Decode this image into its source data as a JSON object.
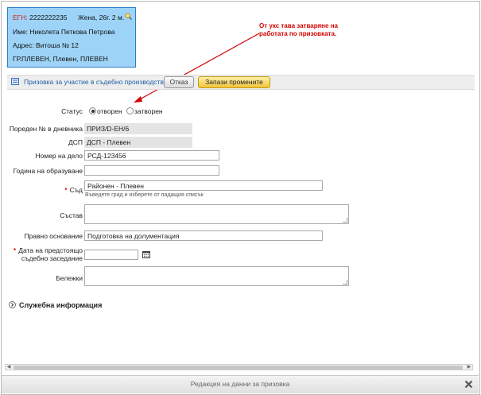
{
  "person": {
    "egn_label": "ЕГН:",
    "egn_value": "2222222235",
    "gender_age": "Жена, 26г. 2 м.",
    "name_line": "Име: Николета Петкова Петрова",
    "address_line": "Адрес: Витоша № 12",
    "city_line": "ГР.ПЛЕВЕН, Плевен, ПЛЕВЕН"
  },
  "annotation": {
    "line1": "От укс тава затваряне на",
    "line2": "работата по призовката."
  },
  "toolbar": {
    "title": "Призовка за участие в съдебно производство",
    "cancel_label": "Отказ",
    "save_label": "Запази промените"
  },
  "form": {
    "status_label": "Статус",
    "status_options": [
      "отворен",
      "затворен"
    ],
    "status_selected": "отворен",
    "journal_no_label": "Пореден № в дневника",
    "journal_no_value": "ПРИЗ/D-ЕН/6",
    "dsp_label": "ДСП",
    "dsp_value": "ДСП - Плевен",
    "case_no_label": "Номер на дело",
    "case_no_value": "РСД-123456",
    "year_label": "Година на образуване",
    "year_value": "",
    "court_label": "Съд",
    "court_value": "Районен - Плевен",
    "court_hint": "Въведете град и изберете от падащия списък",
    "composition_label": "Състав",
    "composition_value": "",
    "legal_basis_label": "Правно основание",
    "legal_basis_value": "Подготовка на долументация",
    "hearing_date_label_1": "Дата на предстоящо",
    "hearing_date_label_2": "съдебно заседание",
    "hearing_date_value": "",
    "notes_label": "Бележки",
    "notes_value": ""
  },
  "section": {
    "official_info_label": "Служебна информация"
  },
  "footer": {
    "title": "Редакция на данни за призовка"
  },
  "colors": {
    "card_bg": "#9dd3f7",
    "annotation": "#d40000",
    "save_button": "#f2c43c",
    "required": "#d11c1c"
  }
}
